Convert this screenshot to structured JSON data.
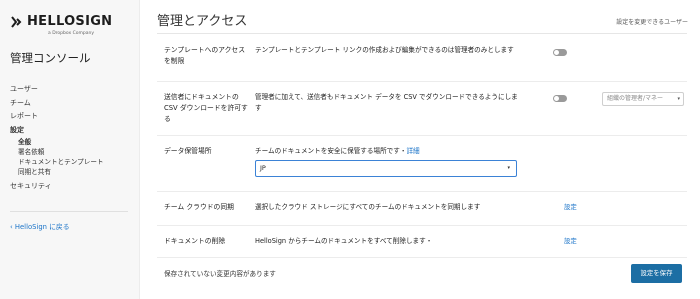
{
  "brand": {
    "name": "HELLOSIGN",
    "sub": "a Dropbox Company"
  },
  "sidebar": {
    "title": "管理コンソール",
    "items": [
      {
        "label": "ユーザー"
      },
      {
        "label": "チーム"
      },
      {
        "label": "レポート"
      },
      {
        "label": "設定"
      }
    ],
    "sub_items": [
      {
        "label": "全般"
      },
      {
        "label": "署名依頼"
      },
      {
        "label": "ドキュメントとテンプレート"
      },
      {
        "label": "同期と共有"
      }
    ],
    "security": "セキュリティ",
    "back_link": "HelloSign に戻る"
  },
  "header": {
    "title": "管理とアクセス",
    "right_text": "設定を変更できるユーザー"
  },
  "rows": [
    {
      "label": "テンプレートへのアクセスを制限",
      "desc": "テンプレートとテンプレート リンクの作成および編集ができるのは管理者のみとします"
    },
    {
      "label": "送信者にドキュメントの CSV ダウンロードを許可する",
      "desc": "管理者に加えて、送信者もドキュメント データを CSV でダウンロードできるようにします",
      "select": "組織の管理者/マネー"
    },
    {
      "label": "データ保管場所",
      "desc": "チームのドキュメントを安全に保管する場所です・",
      "link": "詳細",
      "select": "JP"
    },
    {
      "label": "チーム クラウドの同期",
      "desc": "選択したクラウド ストレージにすべてのチームのドキュメントを同期します",
      "link": "設定"
    },
    {
      "label": "ドキュメントの削除",
      "desc": "HelloSign からチームのドキュメントをすべて削除します・",
      "link": "設定"
    }
  ],
  "footer": {
    "unsaved": "保存されていない変更内容があります",
    "save": "設定を保存"
  },
  "colors": {
    "accent": "#1c6ea4",
    "link": "#1a73c8"
  }
}
